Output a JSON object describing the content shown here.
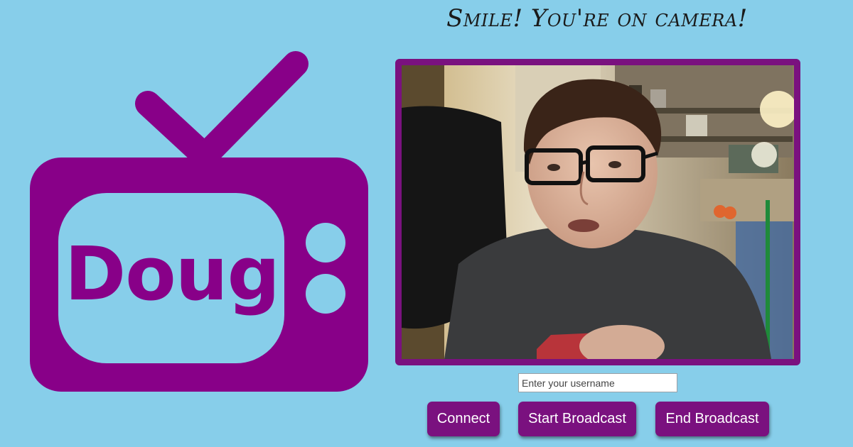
{
  "app": {
    "title": "Smile! You're on camera!",
    "accent_color": "#7a117f",
    "background_color": "#87ceea"
  },
  "logo": {
    "text": "Doug",
    "icon": "tv-icon",
    "color": "#880088"
  },
  "video": {
    "icon": "webcam-feed"
  },
  "username": {
    "value": "",
    "placeholder": "Enter your username"
  },
  "buttons": {
    "connect_label": "Connect",
    "start_label": "Start Broadcast",
    "end_label": "End Broadcast"
  }
}
